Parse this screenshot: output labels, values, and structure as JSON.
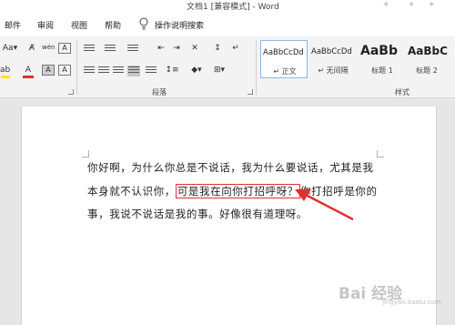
{
  "window": {
    "title": "文档1 [兼容模式] - Word"
  },
  "tabs": [
    {
      "label": "邮件"
    },
    {
      "label": "审阅"
    },
    {
      "label": "视图"
    },
    {
      "label": "帮助"
    },
    {
      "label": "操作说明搜索"
    }
  ],
  "ribbon": {
    "font": {
      "font_color_label": "A",
      "highlight_label": "A",
      "phonetic_label": "wén",
      "enclose_label": "A",
      "shade_label": "A"
    },
    "paragraph": {
      "label": "段落"
    },
    "styles": {
      "label": "样式",
      "items": [
        {
          "sample": "AaBbCcDd",
          "name": "↵ 正文",
          "selected": true
        },
        {
          "sample": "AaBbCcDd",
          "name": "↵ 无间隔",
          "selected": false
        },
        {
          "sample": "AaBb",
          "name": "标题 1",
          "selected": false
        },
        {
          "sample": "AaBbC",
          "name": "标题 2",
          "selected": false
        }
      ]
    }
  },
  "document": {
    "line1": "你好啊，为什么你总是不说话，我为什么要说话，尤其是我",
    "line2_before": "本身就不认识你，",
    "line2_highlight": "可是我在向你打招呼呀？",
    "line2_after": "你打招呼是你的",
    "line3": "事，我说不说话是我的事。好像很有道理呀。"
  },
  "watermark": {
    "text": "Bai 经验",
    "sub": "jingyan.baidu.com"
  },
  "colors": {
    "highlight_box": "#e03030",
    "arrow": "#e03030",
    "font_color_bar": "#e03030",
    "highlight_bar": "#ffe600"
  }
}
